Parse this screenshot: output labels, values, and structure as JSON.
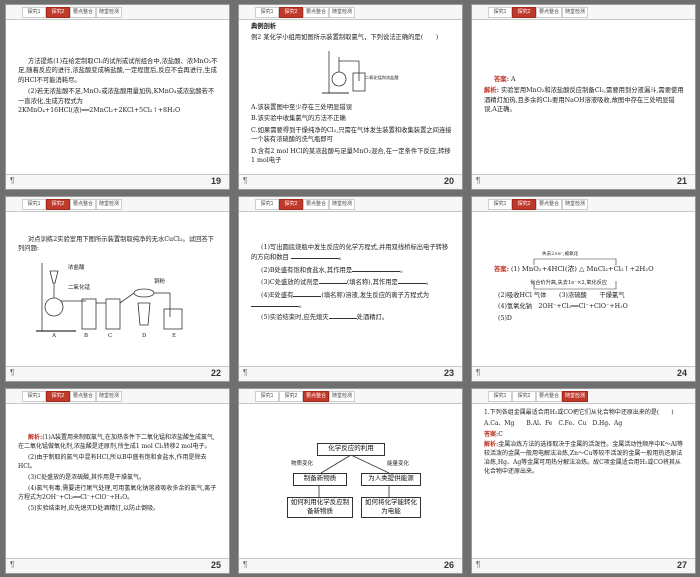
{
  "tabs": [
    "探究1",
    "探究2",
    "要点整合",
    "随堂检测"
  ],
  "footer_icon": "¶",
  "slides": [
    {
      "num": "19",
      "lines": [
        "方法提炼(1)在给定制取Cl₂的试剂或试剂组合中,浓盐酸、浓MnO₂不足,随着反应的进行,浓盐酸变成稀盐酸,一定程度后,反应不会再进行,生成的HCl不可能消耗尽。",
        "(2)若无浓盐酸不足,MnO₂或浓盐酸用量加热,KMnO₄或浓盐酸若不一直浓化,生成方程式为2KMnO₄+16HCl(浓)══2MnCl₂+2KCl+5Cl₂↑+8H₂O"
      ],
      "label": "方法提炼"
    },
    {
      "num": "20",
      "heading": "典例剖析",
      "question": "例2 某化学小组用如图所示装置制取氯气，下列说法正确的是(　　)",
      "figure_label": "二氧化锰和浓盐酸",
      "options": [
        "A.该装置图中至少存在三处明显错误",
        "B.该实验中收集氯气的方法不正确",
        "C.如果需要得到干燥纯净的Cl₂,只需在气体发生装置和收集装置之间连接一个装有浓硫酸的洗气瓶即可",
        "D.含有2 mol HCl的某浓盐酸与足量MnO₂混合,在一定条件下反应,转移1 mol电子"
      ]
    },
    {
      "num": "21",
      "answer_label": "答案:",
      "answer": "A",
      "analysis_label": "解析:",
      "analysis": "实验室用MnO₂和浓盐酸反应制备Cl₂,需要用到分液漏斗,需要使用酒精灯加热,且多余的Cl₂要用NaOH溶液吸收,故图中存在三处明显错误,A正确。"
    },
    {
      "num": "22",
      "lines": [
        "对点训练2实验室用下图所示装置制取纯净的无水CuCl₂。试回答下列问题:"
      ],
      "apparatus_labels": [
        "浓盐酸",
        "二氧化锰",
        "铜粉",
        "A",
        "B",
        "C",
        "D",
        "E"
      ]
    },
    {
      "num": "23",
      "items": [
        "(1)写出圆底烧瓶中发生反应的化学方程式,并用双线桥标出电子转移的方向和数目",
        "(2)B处盛有饱和食盐水,其作用是",
        "(3)C处盛放的试剂是",
        "(填名称),其作用是",
        "(4)E处盛有",
        "(填名称)溶液,发生反应的离子方程式为",
        "(5)实验结束时,应先熄灭",
        "处酒精灯。"
      ]
    },
    {
      "num": "24",
      "answer_label": "答案:",
      "equation_prefix": "(1)",
      "equation": "MnO₂+4HCl(浓) △ MnCl₂+Cl₂↑+2H₂O",
      "upper_note": "失去2×e⁻,被氧化",
      "lower_note": "化合价升高,失去1e⁻×2,氧化反应",
      "answers": [
        "(2)吸收HCl 气体　　(3)浓硫酸　　干燥氯气",
        "(4)氢氧化钠　2OH⁻+Cl₂══Cl⁻+ClO⁻+H₂O",
        "(5)D"
      ]
    },
    {
      "num": "25",
      "analysis_label": "解析:",
      "lines": [
        "(1)A装置用来制取氯气,在加热条件下二氧化锰和浓盐酸生成氯气,在二氧化锰做氧化剂,浓盐酸是还原剂,所生成1 mol Cl₂转移2 mol电子。",
        "(2)由于制取的氯气中混有HCl,所以B中盛有饱和食盐水,作用是除去HCl。",
        "(3)C处盛放的是浓硫酸,其作用是干燥氯气。",
        "(4)氯气有毒,需要进行尾气处理,可用氢氧化钠溶液吸收多余的氯气,离子方程式为2OH⁻+Cl₂══Cl⁻+ClO⁻+H₂O。",
        "(5)实验结束时,应先熄灭D处酒精灯,以防止倒吸。"
      ]
    },
    {
      "num": "26",
      "top": "化学反应的利用",
      "left_label": "物质变化",
      "right_label": "能量变化",
      "mid_left": "制备新物质",
      "mid_right": "为人类提供能源",
      "bot_left": "如何利用化学反应制备新物质",
      "bot_right": "如何将化学能转化为电能"
    },
    {
      "num": "27",
      "question": "1.下列各组金属最适合用H₂或CO把它们从化合物中还原出来的是(　　)",
      "options": "A.Ca、Mg　　B.Al、Fe　C.Fe、Cu　D.Hg、Ag",
      "answer_label": "答案:",
      "answer": "C",
      "analysis_label": "解析:",
      "analysis": "金属冶炼方法的选择取决于金属的活泼性。金属活动性顺序中K～Al等较活泼的金属一般用电解法冶炼,Zn～Cu等较不活泼的金属一般用热还原法冶炼,Hg、Ag等金属可用热分解法冶炼。故C项金属适合用H₂或CO将其从化合物中还原出来。"
    }
  ]
}
